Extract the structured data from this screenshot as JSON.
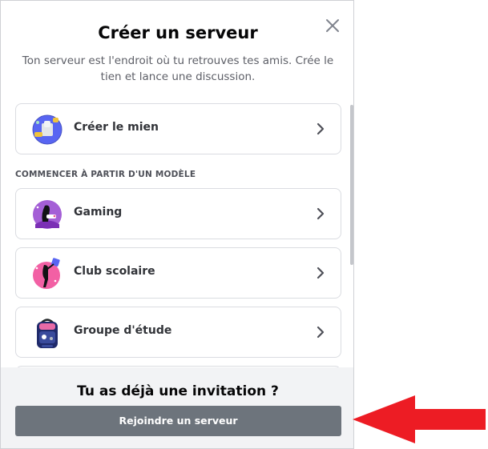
{
  "modal": {
    "title": "Créer un serveur",
    "subtitle": "Ton serveur est l'endroit où tu retrouves tes amis. Crée le tien et lance une discussion.",
    "close_icon": "close-icon"
  },
  "options": {
    "create": {
      "label": "Créer le mien",
      "icon": "globe-create-icon"
    },
    "section_label": "COMMENCER À PARTIR D'UN MODÈLE",
    "templates": [
      {
        "label": "Gaming",
        "icon": "gaming-icon"
      },
      {
        "label": "Club scolaire",
        "icon": "school-club-icon"
      },
      {
        "label": "Groupe d'étude",
        "icon": "study-group-icon"
      }
    ]
  },
  "footer": {
    "title": "Tu as déjà une invitation ?",
    "join_label": "Rejoindre un serveur"
  },
  "colors": {
    "annotation_arrow": "#ed1c24",
    "join_button": "#6d747c",
    "footer_bg": "#f2f3f5"
  }
}
